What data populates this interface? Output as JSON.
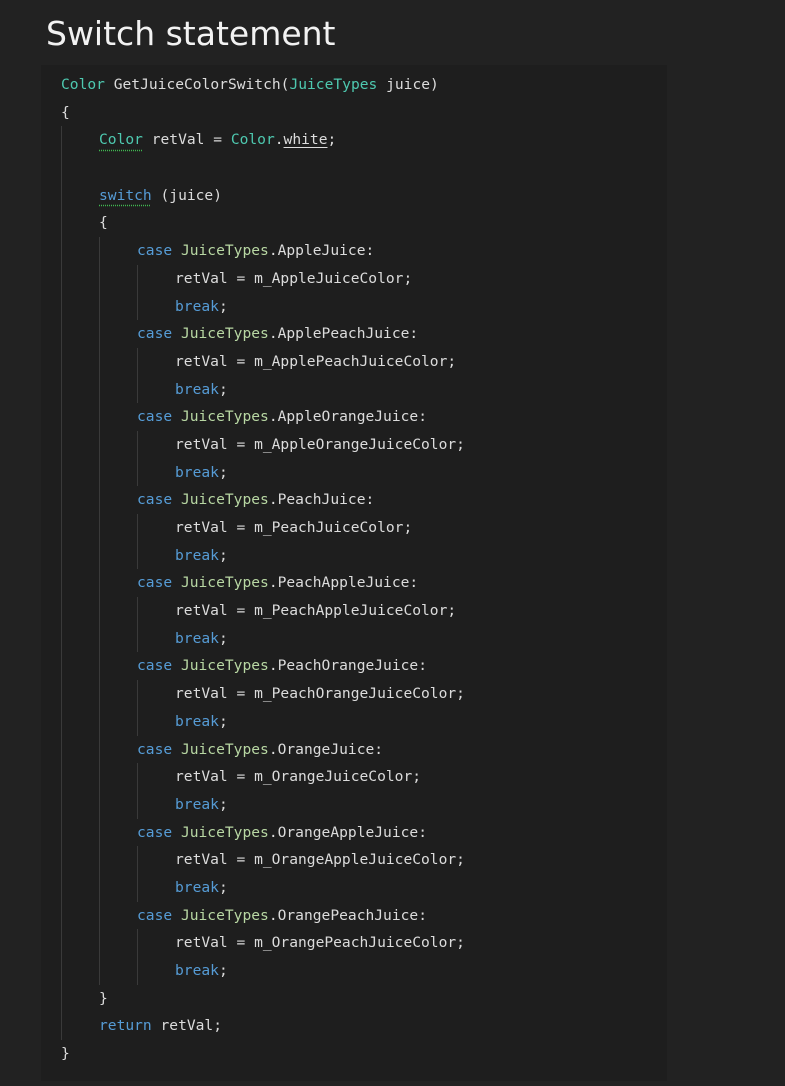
{
  "page": {
    "title": "Switch statement"
  },
  "colors": {
    "page_background": "#222222",
    "code_background": "#1e1e1e",
    "keyword": "#569cd6",
    "type": "#4ec9b0",
    "enum_type": "#b8d7a3",
    "plain": "#dcdcdc",
    "squiggle": "#3fb950"
  },
  "code": {
    "lines": [
      {
        "indent": 0,
        "tokens": [
          {
            "t": "Color",
            "c": "type"
          },
          {
            "t": " GetJuiceColorSwitch(",
            "c": "plain"
          },
          {
            "t": "JuiceTypes",
            "c": "type"
          },
          {
            "t": " juice)",
            "c": "plain"
          }
        ]
      },
      {
        "indent": 0,
        "tokens": [
          {
            "t": "{",
            "c": "plain"
          }
        ]
      },
      {
        "indent": 1,
        "tokens": [
          {
            "t": "Color",
            "c": "type",
            "s": "squiggle"
          },
          {
            "t": " retVal = ",
            "c": "plain"
          },
          {
            "t": "Color",
            "c": "type"
          },
          {
            "t": ".",
            "c": "plain"
          },
          {
            "t": "white",
            "c": "plain",
            "s": "underline"
          },
          {
            "t": ";",
            "c": "plain"
          }
        ]
      },
      {
        "indent": 1,
        "tokens": []
      },
      {
        "indent": 1,
        "tokens": [
          {
            "t": "switch",
            "c": "keyword",
            "s": "squiggle"
          },
          {
            "t": " (juice)",
            "c": "plain"
          }
        ]
      },
      {
        "indent": 1,
        "tokens": [
          {
            "t": "{",
            "c": "plain"
          }
        ]
      },
      {
        "indent": 2,
        "tokens": [
          {
            "t": "case",
            "c": "keyword"
          },
          {
            "t": " ",
            "c": "plain"
          },
          {
            "t": "JuiceTypes",
            "c": "enum"
          },
          {
            "t": ".AppleJuice:",
            "c": "plain"
          }
        ]
      },
      {
        "indent": 3,
        "tokens": [
          {
            "t": "retVal = m_AppleJuiceColor;",
            "c": "plain"
          }
        ]
      },
      {
        "indent": 3,
        "tokens": [
          {
            "t": "break",
            "c": "keyword"
          },
          {
            "t": ";",
            "c": "plain"
          }
        ]
      },
      {
        "indent": 2,
        "tokens": [
          {
            "t": "case",
            "c": "keyword"
          },
          {
            "t": " ",
            "c": "plain"
          },
          {
            "t": "JuiceTypes",
            "c": "enum"
          },
          {
            "t": ".ApplePeachJuice:",
            "c": "plain"
          }
        ]
      },
      {
        "indent": 3,
        "tokens": [
          {
            "t": "retVal = m_ApplePeachJuiceColor;",
            "c": "plain"
          }
        ]
      },
      {
        "indent": 3,
        "tokens": [
          {
            "t": "break",
            "c": "keyword"
          },
          {
            "t": ";",
            "c": "plain"
          }
        ]
      },
      {
        "indent": 2,
        "tokens": [
          {
            "t": "case",
            "c": "keyword"
          },
          {
            "t": " ",
            "c": "plain"
          },
          {
            "t": "JuiceTypes",
            "c": "enum"
          },
          {
            "t": ".AppleOrangeJuice:",
            "c": "plain"
          }
        ]
      },
      {
        "indent": 3,
        "tokens": [
          {
            "t": "retVal = m_AppleOrangeJuiceColor;",
            "c": "plain"
          }
        ]
      },
      {
        "indent": 3,
        "tokens": [
          {
            "t": "break",
            "c": "keyword"
          },
          {
            "t": ";",
            "c": "plain"
          }
        ]
      },
      {
        "indent": 2,
        "tokens": [
          {
            "t": "case",
            "c": "keyword"
          },
          {
            "t": " ",
            "c": "plain"
          },
          {
            "t": "JuiceTypes",
            "c": "enum"
          },
          {
            "t": ".PeachJuice:",
            "c": "plain"
          }
        ]
      },
      {
        "indent": 3,
        "tokens": [
          {
            "t": "retVal = m_PeachJuiceColor;",
            "c": "plain"
          }
        ]
      },
      {
        "indent": 3,
        "tokens": [
          {
            "t": "break",
            "c": "keyword"
          },
          {
            "t": ";",
            "c": "plain"
          }
        ]
      },
      {
        "indent": 2,
        "tokens": [
          {
            "t": "case",
            "c": "keyword"
          },
          {
            "t": " ",
            "c": "plain"
          },
          {
            "t": "JuiceTypes",
            "c": "enum"
          },
          {
            "t": ".PeachAppleJuice:",
            "c": "plain"
          }
        ]
      },
      {
        "indent": 3,
        "tokens": [
          {
            "t": "retVal = m_PeachAppleJuiceColor;",
            "c": "plain"
          }
        ]
      },
      {
        "indent": 3,
        "tokens": [
          {
            "t": "break",
            "c": "keyword"
          },
          {
            "t": ";",
            "c": "plain"
          }
        ]
      },
      {
        "indent": 2,
        "tokens": [
          {
            "t": "case",
            "c": "keyword"
          },
          {
            "t": " ",
            "c": "plain"
          },
          {
            "t": "JuiceTypes",
            "c": "enum"
          },
          {
            "t": ".PeachOrangeJuice:",
            "c": "plain"
          }
        ]
      },
      {
        "indent": 3,
        "tokens": [
          {
            "t": "retVal = m_PeachOrangeJuiceColor;",
            "c": "plain"
          }
        ]
      },
      {
        "indent": 3,
        "tokens": [
          {
            "t": "break",
            "c": "keyword"
          },
          {
            "t": ";",
            "c": "plain"
          }
        ]
      },
      {
        "indent": 2,
        "tokens": [
          {
            "t": "case",
            "c": "keyword"
          },
          {
            "t": " ",
            "c": "plain"
          },
          {
            "t": "JuiceTypes",
            "c": "enum"
          },
          {
            "t": ".OrangeJuice:",
            "c": "plain"
          }
        ]
      },
      {
        "indent": 3,
        "tokens": [
          {
            "t": "retVal = m_OrangeJuiceColor;",
            "c": "plain"
          }
        ]
      },
      {
        "indent": 3,
        "tokens": [
          {
            "t": "break",
            "c": "keyword"
          },
          {
            "t": ";",
            "c": "plain"
          }
        ]
      },
      {
        "indent": 2,
        "tokens": [
          {
            "t": "case",
            "c": "keyword"
          },
          {
            "t": " ",
            "c": "plain"
          },
          {
            "t": "JuiceTypes",
            "c": "enum"
          },
          {
            "t": ".OrangeAppleJuice:",
            "c": "plain"
          }
        ]
      },
      {
        "indent": 3,
        "tokens": [
          {
            "t": "retVal = m_OrangeAppleJuiceColor;",
            "c": "plain"
          }
        ]
      },
      {
        "indent": 3,
        "tokens": [
          {
            "t": "break",
            "c": "keyword"
          },
          {
            "t": ";",
            "c": "plain"
          }
        ]
      },
      {
        "indent": 2,
        "tokens": [
          {
            "t": "case",
            "c": "keyword"
          },
          {
            "t": " ",
            "c": "plain"
          },
          {
            "t": "JuiceTypes",
            "c": "enum"
          },
          {
            "t": ".OrangePeachJuice:",
            "c": "plain"
          }
        ]
      },
      {
        "indent": 3,
        "tokens": [
          {
            "t": "retVal = m_OrangePeachJuiceColor;",
            "c": "plain"
          }
        ]
      },
      {
        "indent": 3,
        "tokens": [
          {
            "t": "break",
            "c": "keyword"
          },
          {
            "t": ";",
            "c": "plain"
          }
        ]
      },
      {
        "indent": 1,
        "tokens": [
          {
            "t": "}",
            "c": "plain"
          }
        ]
      },
      {
        "indent": 1,
        "tokens": [
          {
            "t": "return",
            "c": "keyword"
          },
          {
            "t": " retVal;",
            "c": "plain"
          }
        ]
      },
      {
        "indent": 0,
        "tokens": [
          {
            "t": "}",
            "c": "plain"
          }
        ]
      }
    ]
  }
}
